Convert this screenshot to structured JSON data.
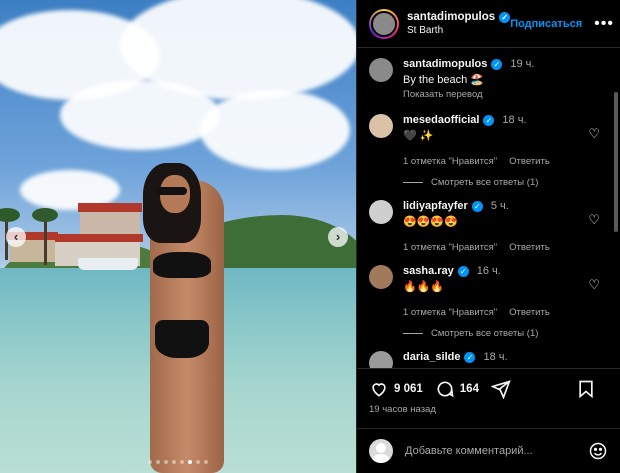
{
  "header": {
    "username": "santadimopulos",
    "location": "St Barth",
    "follow_label": "Подписаться",
    "more_icon": "more-horizontal-icon"
  },
  "caption": {
    "username": "santadimopulos",
    "time": "19 ч.",
    "text": "By the beach 🏖️",
    "translate_label": "Показать перевод"
  },
  "comments": [
    {
      "username": "mesedaofficial",
      "time": "18 ч.",
      "text": "🖤 ✨",
      "likes": "1 отметка \"Нравится\"",
      "reply": "Ответить",
      "view_replies": "Смотреть все ответы (1)",
      "avatar_color": "#d9c2a8"
    },
    {
      "username": "lidiyapfayfer",
      "time": "5 ч.",
      "text": "😍😍😍😍",
      "likes": "1 отметка \"Нравится\"",
      "reply": "Ответить",
      "view_replies": "",
      "avatar_color": "#cfcfcf"
    },
    {
      "username": "sasha.ray",
      "time": "16 ч.",
      "text": "🔥🔥🔥",
      "likes": "1 отметка \"Нравится\"",
      "reply": "Ответить",
      "view_replies": "Смотреть все ответы (1)",
      "avatar_color": "#a07a5a"
    },
    {
      "username": "daria_silde",
      "time": "18 ч.",
      "text": "",
      "likes": "",
      "reply": "",
      "view_replies": "",
      "avatar_color": "#9a9a9a"
    }
  ],
  "actions": {
    "like_count": "9 061",
    "comment_count": "164",
    "time_ago": "19 часов назад"
  },
  "add_comment": {
    "placeholder": "Добавьте комментарий..."
  },
  "colors": {
    "accent": "#0095f6",
    "background": "#000000",
    "muted": "#a8a8a8"
  },
  "carousel": {
    "dot_count": 8,
    "active_index": 5
  }
}
